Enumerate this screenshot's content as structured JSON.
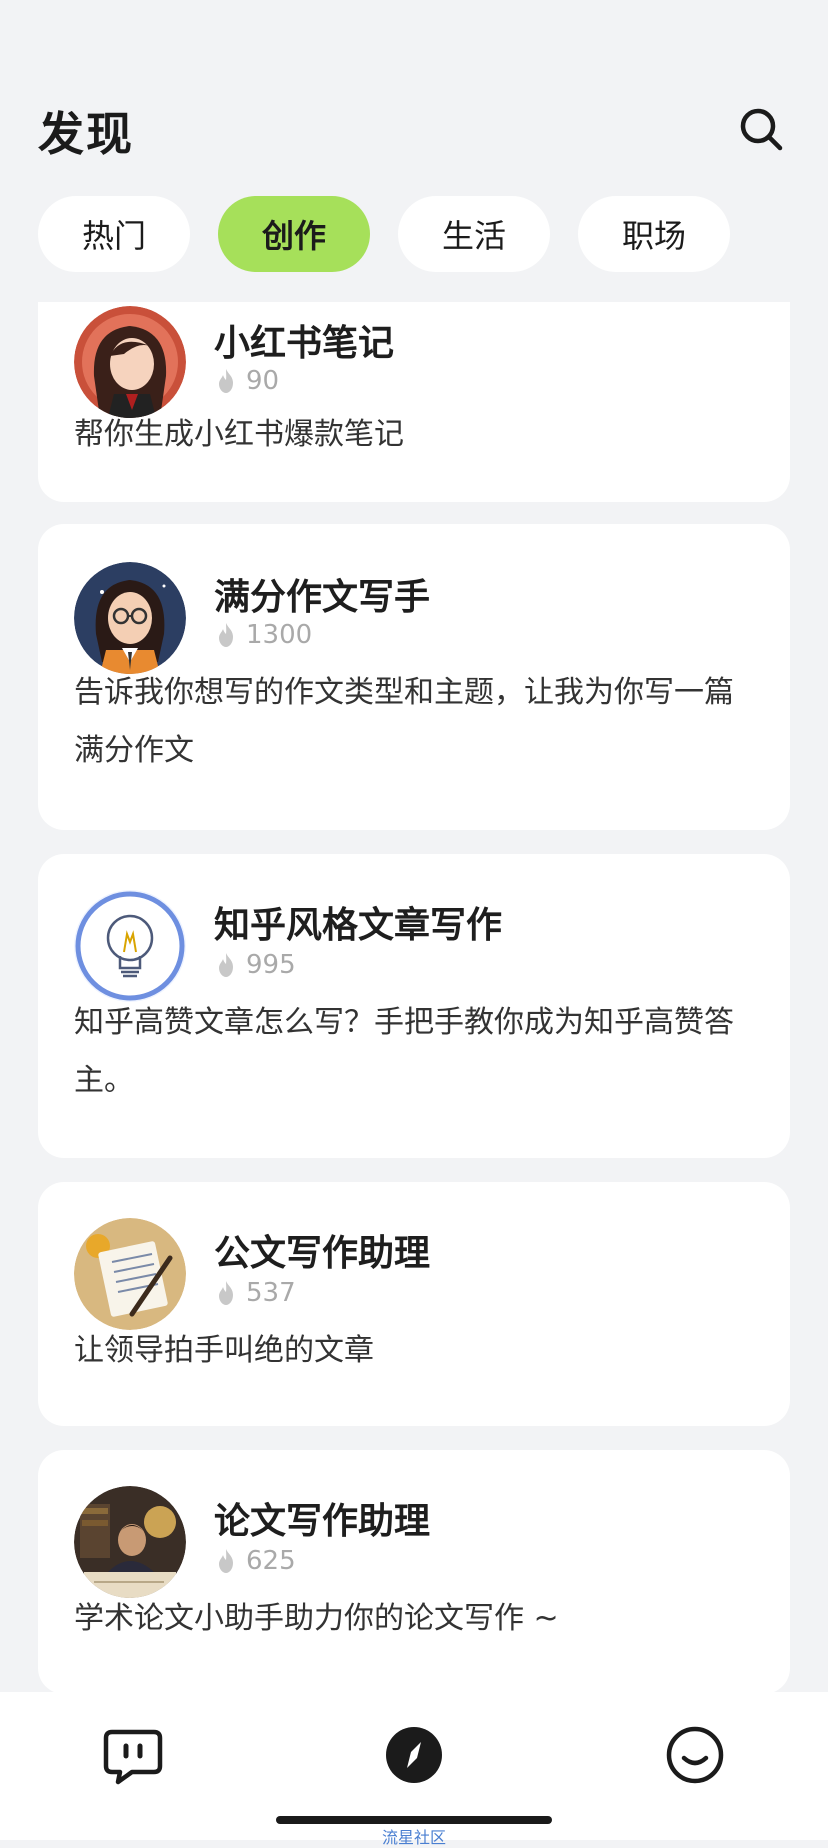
{
  "header": {
    "title": "发现"
  },
  "tabs": [
    {
      "label": "热门",
      "active": false
    },
    {
      "label": "创作",
      "active": true
    },
    {
      "label": "生活",
      "active": false
    },
    {
      "label": "职场",
      "active": false
    }
  ],
  "cards": [
    {
      "title": "小红书笔记",
      "heat": "90",
      "description": "帮你生成小红书爆款笔记",
      "avatar": "girl-red-avatar"
    },
    {
      "title": "满分作文写手",
      "heat": "1300",
      "description": "告诉我你想写的作文类型和主题，让我为你写一篇满分作文",
      "avatar": "student-glasses-avatar"
    },
    {
      "title": "知乎风格文章写作",
      "heat": "995",
      "description": "知乎高赞文章怎么写？手把手教你成为知乎高赞答主。",
      "avatar": "lightbulb-avatar"
    },
    {
      "title": "公文写作助理",
      "heat": "537",
      "description": "让领导拍手叫绝的文章",
      "avatar": "document-pen-avatar"
    },
    {
      "title": "论文写作助理",
      "heat": "625",
      "description": "学术论文小助手助力你的论文写作 ~",
      "avatar": "scholar-desk-avatar"
    }
  ],
  "bottom_nav": [
    {
      "icon": "chat-bubble-icon"
    },
    {
      "icon": "compass-icon"
    },
    {
      "icon": "smile-icon"
    }
  ],
  "watermark": "流星社区",
  "colors": {
    "accent": "#a6e05a",
    "background": "#f2f3f5"
  }
}
